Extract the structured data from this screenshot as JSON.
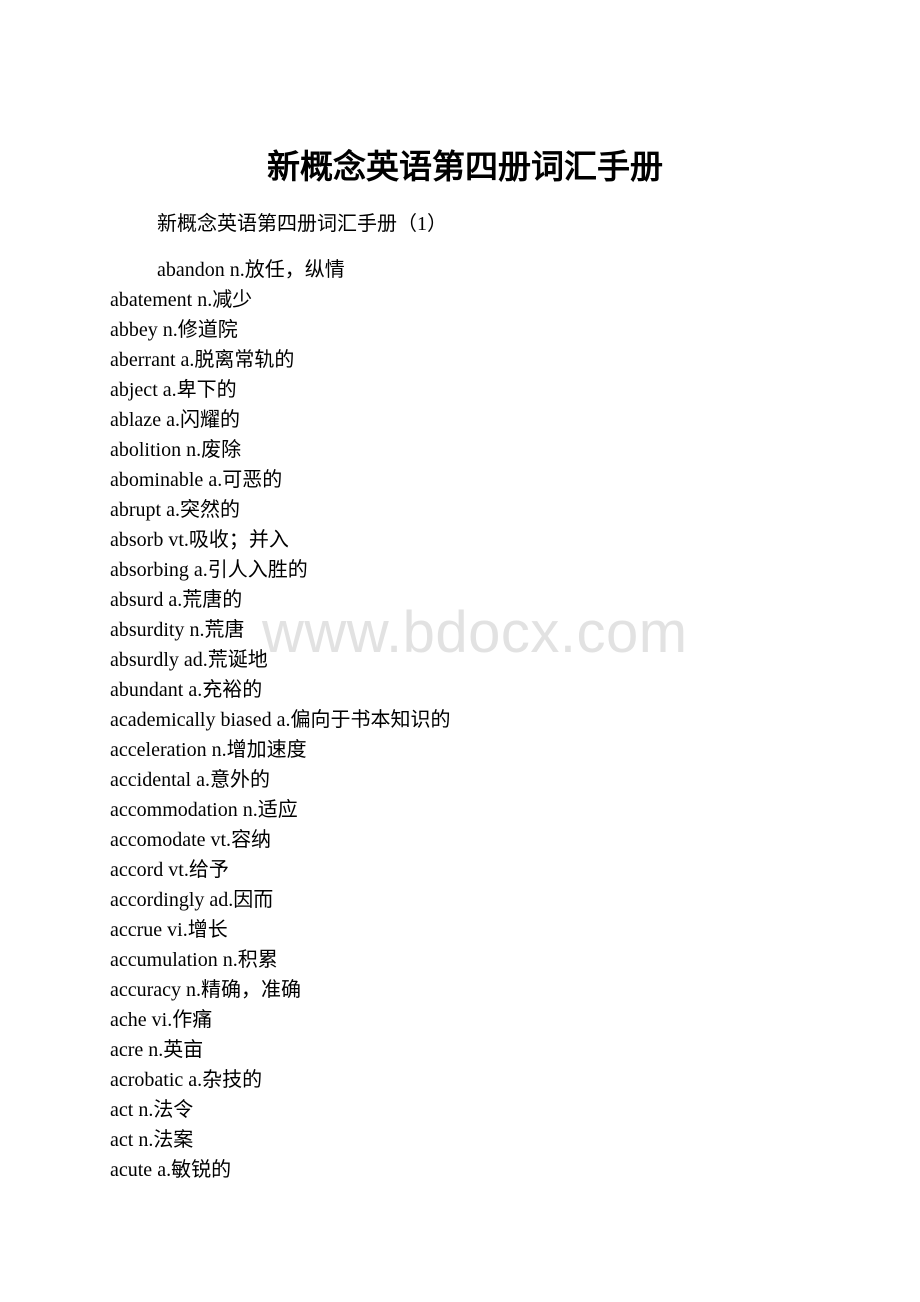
{
  "document": {
    "title": "新概念英语第四册词汇手册",
    "section_heading": "新概念英语第四册词汇手册（1）",
    "watermark": "www.bdocx.com",
    "first_entry": {
      "word": "abandon",
      "pos": "n.",
      "meaning": "放任，纵情"
    },
    "entries": [
      {
        "word": "abatement",
        "pos": "n.",
        "meaning": "减少"
      },
      {
        "word": "abbey",
        "pos": "n.",
        "meaning": "修道院"
      },
      {
        "word": "aberrant",
        "pos": "a.",
        "meaning": "脱离常轨的"
      },
      {
        "word": "abject",
        "pos": "a.",
        "meaning": "卑下的"
      },
      {
        "word": "ablaze",
        "pos": "a.",
        "meaning": "闪耀的"
      },
      {
        "word": "abolition",
        "pos": "n.",
        "meaning": "废除"
      },
      {
        "word": "abominable",
        "pos": "a.",
        "meaning": "可恶的"
      },
      {
        "word": "abrupt",
        "pos": "a.",
        "meaning": "突然的"
      },
      {
        "word": "absorb",
        "pos": "vt.",
        "meaning": "吸收；并入"
      },
      {
        "word": "absorbing",
        "pos": "a.",
        "meaning": "引人入胜的"
      },
      {
        "word": "absurd",
        "pos": "a.",
        "meaning": "荒唐的"
      },
      {
        "word": "absurdity",
        "pos": "n.",
        "meaning": "荒唐"
      },
      {
        "word": "absurdly",
        "pos": "ad.",
        "meaning": "荒诞地"
      },
      {
        "word": "abundant",
        "pos": "a.",
        "meaning": "充裕的"
      },
      {
        "word": "academically biased",
        "pos": "a.",
        "meaning": "偏向于书本知识的"
      },
      {
        "word": "acceleration",
        "pos": "n.",
        "meaning": "增加速度"
      },
      {
        "word": "accidental",
        "pos": "a.",
        "meaning": "意外的"
      },
      {
        "word": "accommodation",
        "pos": "n.",
        "meaning": "适应"
      },
      {
        "word": "accomodate",
        "pos": "vt.",
        "meaning": "容纳"
      },
      {
        "word": "accord",
        "pos": "vt.",
        "meaning": "给予"
      },
      {
        "word": "accordingly",
        "pos": "ad.",
        "meaning": "因而"
      },
      {
        "word": "accrue",
        "pos": "vi.",
        "meaning": "增长"
      },
      {
        "word": "accumulation",
        "pos": "n.",
        "meaning": "积累"
      },
      {
        "word": "accuracy",
        "pos": "n.",
        "meaning": "精确，准确"
      },
      {
        "word": "ache",
        "pos": "vi.",
        "meaning": "作痛"
      },
      {
        "word": "acre",
        "pos": "n.",
        "meaning": "英亩"
      },
      {
        "word": "acrobatic",
        "pos": "a.",
        "meaning": "杂技的"
      },
      {
        "word": "act",
        "pos": "n.",
        "meaning": "法令"
      },
      {
        "word": "act",
        "pos": "n.",
        "meaning": "法案"
      },
      {
        "word": "acute",
        "pos": "a.",
        "meaning": "敏锐的"
      }
    ]
  }
}
